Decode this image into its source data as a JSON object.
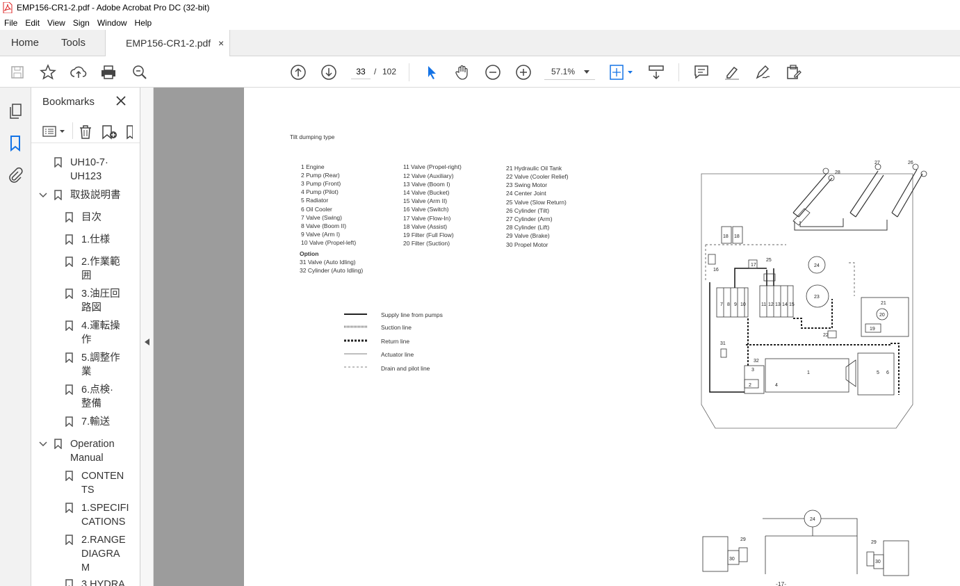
{
  "window": {
    "title": "EMP156-CR1-2.pdf - Adobe Acrobat Pro DC (32-bit)"
  },
  "menu": [
    "File",
    "Edit",
    "View",
    "Sign",
    "Window",
    "Help"
  ],
  "tabs": {
    "home": "Home",
    "tools": "Tools",
    "document": "EMP156-CR1-2.pdf",
    "close": "×"
  },
  "toolbar": {
    "page_current": "33",
    "page_sep": "/",
    "page_total": "102",
    "zoom": "57.1%"
  },
  "bookmarks": {
    "title": "Bookmarks",
    "items": [
      {
        "label": "UH10-7·\nUH123"
      },
      {
        "label": "取扱説明書"
      },
      {
        "label": "目次"
      },
      {
        "label": "1.仕様"
      },
      {
        "label": "2.作業範\n囲"
      },
      {
        "label": "3.油圧回\n路図"
      },
      {
        "label": "4.運転操\n作"
      },
      {
        "label": "5.調整作\n業"
      },
      {
        "label": "6.点検·\n整備"
      },
      {
        "label": "7.輸送"
      },
      {
        "label": "Operation\nManual"
      },
      {
        "label": "CONTEN\nTS"
      },
      {
        "label": "1.SPECIFI\nCATIONS"
      },
      {
        "label": "2.RANGE\nDIAGRA\nM"
      },
      {
        "label": "3.HYDRA"
      }
    ]
  },
  "document": {
    "heading": "Tilt dumping type",
    "parts_col1": [
      "1   Engine",
      "2   Pump (Rear)",
      "3   Pump (Front)",
      "4   Pump (Pilot)",
      "5   Radiator",
      "6   Oil Cooler",
      "7   Valve (Swing)",
      "8   Valve (Boom II)",
      "9   Valve (Arm I)",
      "10  Valve (Propel-left)"
    ],
    "option_label": "Option",
    "parts_option": [
      "31  Valve (Auto Idling)",
      "32  Cylinder (Auto Idling)"
    ],
    "parts_col2": [
      "11  Valve (Propel-right)",
      "12  Valve (Auxiliary)",
      "13  Valve (Boom I)",
      "14  Valve (Bucket)",
      "15  Valve (Arm II)",
      "16  Valve (Switch)",
      "17  Valve (Flow-In)",
      "18  Valve (Assist)",
      "19  Filter (Full Flow)",
      "20  Filter (Suction)"
    ],
    "parts_col3": [
      "21  Hydraulic Oil Tank",
      "22  Valve (Cooler Relief)",
      "23  Swing Motor",
      "24  Center Joint",
      "25  Valve (Slow Return)",
      "26  Cylinder (Tilt)",
      "27  Cylinder (Arm)",
      "28  Cylinder (Lift)",
      "29  Valve (Brake)",
      "30  Propel Motor"
    ],
    "legend": [
      "Supply line from pumps",
      "Suction line",
      "Return line",
      "Actuator line",
      "Drain and pilot line"
    ],
    "page_number": "-17-"
  }
}
